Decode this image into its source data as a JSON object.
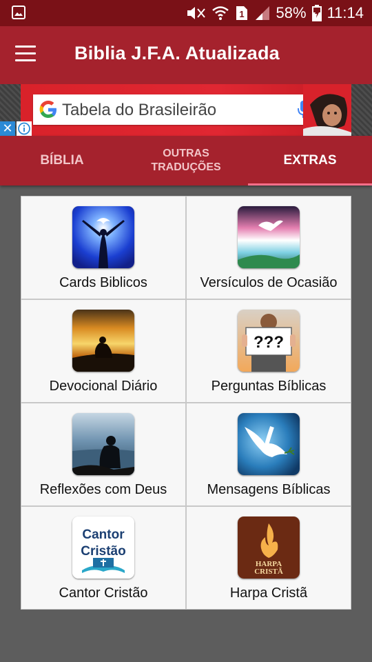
{
  "status_bar": {
    "battery": "58%",
    "time": "11:14",
    "sim_slot": "1"
  },
  "app_bar": {
    "title": "Biblia J.F.A. Atualizada"
  },
  "ad": {
    "query": "Tabela do Brasileirão",
    "close_glyph": "✕"
  },
  "tabs": [
    {
      "label": "BÍBLIA",
      "active": false
    },
    {
      "label": "OUTRAS TRADUÇÕES",
      "active": false
    },
    {
      "label": "EXTRAS",
      "active": true
    }
  ],
  "extras": [
    {
      "label": "Cards Biblicos",
      "icon": "dove-worship-icon"
    },
    {
      "label": "Versículos de Ocasião",
      "icon": "dove-sky-icon"
    },
    {
      "label": "Devocional Diário",
      "icon": "praying-sunset-icon"
    },
    {
      "label": "Perguntas Bíblicas",
      "icon": "question-sign-icon",
      "icon_text": "???"
    },
    {
      "label": "Reflexões com Deus",
      "icon": "reflection-sea-icon"
    },
    {
      "label": "Mensagens Bíblicas",
      "icon": "dove-olive-icon"
    },
    {
      "label": "Cantor Cristão",
      "icon": "cantor-cristao-logo",
      "icon_text": "Cantor Cristão"
    },
    {
      "label": "Harpa Cristã",
      "icon": "harpa-crista-logo",
      "icon_text": "HARPA CRISTÃ"
    }
  ],
  "colors": {
    "status_bar": "#7a1117",
    "primary": "#a5222d",
    "tab_indicator": "#ff6f8a",
    "background": "#5d5d5d"
  }
}
